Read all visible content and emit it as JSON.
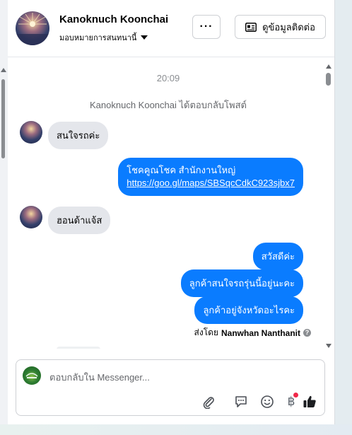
{
  "header": {
    "name": "Kanoknuch Koonchai",
    "assign_label": "มอบหมายการสนทนานี้",
    "more_label": "···",
    "contact_button_label": "ดูข้อมูลติดต่อ"
  },
  "thread": {
    "timestamp": "20:09",
    "notice": "Kanoknuch Koonchai ได้ตอบกลับโพสต์",
    "messages": [
      {
        "dir": "in",
        "text": "สนใจรถค่ะ"
      },
      {
        "dir": "out",
        "line1": "โชคคูณโชค สำนักงานใหญ่",
        "link": "https://goo.gl/maps/SBSqcCdkC923sjbx7"
      },
      {
        "dir": "in",
        "text": "ฮอนด้าแจ้ส"
      },
      {
        "dir": "out",
        "text": "สวัสดีค่ะ"
      },
      {
        "dir": "out",
        "text": "ลูกค้าสนใจรถรุ่นนี้อยู่นะคะ"
      },
      {
        "dir": "out",
        "text": "ลูกค้าอยู่จังหวัดอะไรคะ"
      }
    ],
    "sent_by_prefix": "ส่งโดย",
    "sent_by_name": "Nanwhan Nanthanit"
  },
  "composer": {
    "placeholder": "ตอบกลับใน Messenger...",
    "tools": [
      "paperclip-icon",
      "saved-reply-icon",
      "emoji-icon",
      "baht-payment-icon",
      "like-icon"
    ],
    "baht_symbol": "฿"
  },
  "colors": {
    "outgoing_bubble": "#0a7cff",
    "incoming_bubble": "#e4e6eb",
    "notification_dot": "#f02849"
  }
}
